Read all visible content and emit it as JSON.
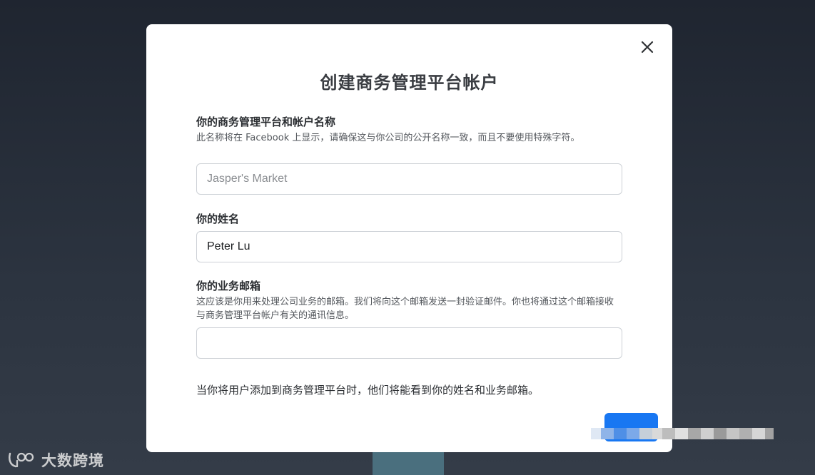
{
  "dialog": {
    "title": "创建商务管理平台帐户",
    "close_icon": "close-icon"
  },
  "business_name": {
    "label": "你的商务管理平台和帐户名称",
    "help": "此名称将在 Facebook 上显示，请确保这与你公司的公开名称一致，而且不要使用特殊字符。",
    "value": "",
    "placeholder": "Jasper's Market"
  },
  "your_name": {
    "label": "你的姓名",
    "value": "Peter Lu"
  },
  "business_email": {
    "label": "你的业务邮箱",
    "help": "这应该是你用来处理公司业务的邮箱。我们将向这个邮箱发送一封验证邮件。你也将通过这个邮箱接收与商务管理平台帐户有关的通讯信息。",
    "value": "",
    "placeholder": ""
  },
  "footer_note": "当你将用户添加到商务管理平台时，他们将能看到你的姓名和业务邮箱。",
  "next_button": {
    "label": ""
  },
  "watermark": {
    "text": "大数跨境"
  },
  "colors": {
    "primary_button": "#1877f2",
    "modal_bg": "#ffffff",
    "backdrop": "#252c37"
  }
}
